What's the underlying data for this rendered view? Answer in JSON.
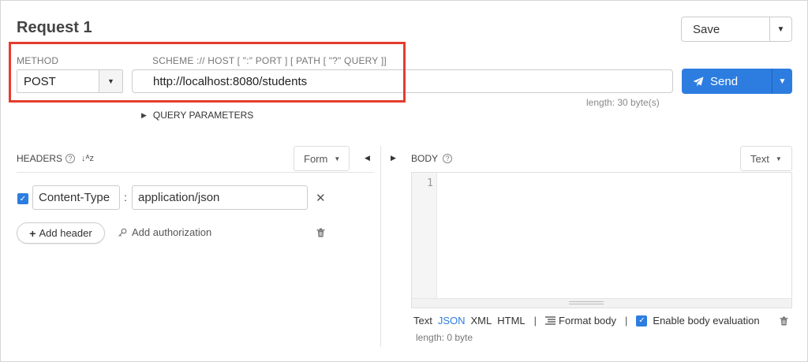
{
  "request": {
    "title": "Request 1"
  },
  "toolbar": {
    "save_label": "Save",
    "send_label": "Send"
  },
  "method": {
    "label": "METHOD",
    "value": "POST"
  },
  "url": {
    "scheme_label": "SCHEME :// HOST [ \":\" PORT ] [ PATH [ \"?\" QUERY ]]",
    "value": "http://localhost:8080/students",
    "length_text": "length: 30 byte(s)"
  },
  "query_params": {
    "label": "QUERY PARAMETERS"
  },
  "headers": {
    "title": "HEADERS",
    "mode": "Form",
    "items": [
      {
        "key": "Content-Type",
        "value": "application/json",
        "enabled": true
      }
    ],
    "add_header_label": "Add header",
    "add_auth_label": "Add authorization"
  },
  "body": {
    "title": "BODY",
    "mode": "Text",
    "line_numbers": [
      "1"
    ],
    "formats": [
      "Text",
      "JSON",
      "XML",
      "HTML"
    ],
    "active_format": "JSON",
    "format_body_label": "Format body",
    "enable_eval_label": "Enable body evaluation",
    "length_text": "length: 0 byte"
  },
  "colors": {
    "accent": "#2d7de0",
    "highlight": "#e53c2e"
  }
}
